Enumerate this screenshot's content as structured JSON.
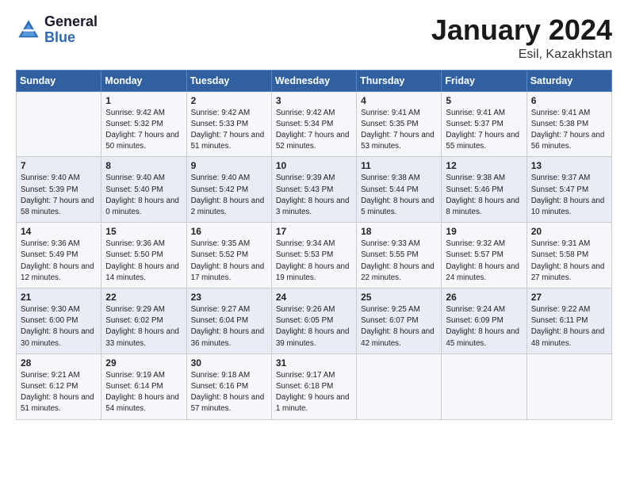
{
  "header": {
    "logo_general": "General",
    "logo_blue": "Blue",
    "title": "January 2024",
    "location": "Esil, Kazakhstan"
  },
  "weekdays": [
    "Sunday",
    "Monday",
    "Tuesday",
    "Wednesday",
    "Thursday",
    "Friday",
    "Saturday"
  ],
  "weeks": [
    [
      {
        "day": "",
        "sunrise": "",
        "sunset": "",
        "daylight": ""
      },
      {
        "day": "1",
        "sunrise": "Sunrise: 9:42 AM",
        "sunset": "Sunset: 5:32 PM",
        "daylight": "Daylight: 7 hours and 50 minutes."
      },
      {
        "day": "2",
        "sunrise": "Sunrise: 9:42 AM",
        "sunset": "Sunset: 5:33 PM",
        "daylight": "Daylight: 7 hours and 51 minutes."
      },
      {
        "day": "3",
        "sunrise": "Sunrise: 9:42 AM",
        "sunset": "Sunset: 5:34 PM",
        "daylight": "Daylight: 7 hours and 52 minutes."
      },
      {
        "day": "4",
        "sunrise": "Sunrise: 9:41 AM",
        "sunset": "Sunset: 5:35 PM",
        "daylight": "Daylight: 7 hours and 53 minutes."
      },
      {
        "day": "5",
        "sunrise": "Sunrise: 9:41 AM",
        "sunset": "Sunset: 5:37 PM",
        "daylight": "Daylight: 7 hours and 55 minutes."
      },
      {
        "day": "6",
        "sunrise": "Sunrise: 9:41 AM",
        "sunset": "Sunset: 5:38 PM",
        "daylight": "Daylight: 7 hours and 56 minutes."
      }
    ],
    [
      {
        "day": "7",
        "sunrise": "Sunrise: 9:40 AM",
        "sunset": "Sunset: 5:39 PM",
        "daylight": "Daylight: 7 hours and 58 minutes."
      },
      {
        "day": "8",
        "sunrise": "Sunrise: 9:40 AM",
        "sunset": "Sunset: 5:40 PM",
        "daylight": "Daylight: 8 hours and 0 minutes."
      },
      {
        "day": "9",
        "sunrise": "Sunrise: 9:40 AM",
        "sunset": "Sunset: 5:42 PM",
        "daylight": "Daylight: 8 hours and 2 minutes."
      },
      {
        "day": "10",
        "sunrise": "Sunrise: 9:39 AM",
        "sunset": "Sunset: 5:43 PM",
        "daylight": "Daylight: 8 hours and 3 minutes."
      },
      {
        "day": "11",
        "sunrise": "Sunrise: 9:38 AM",
        "sunset": "Sunset: 5:44 PM",
        "daylight": "Daylight: 8 hours and 5 minutes."
      },
      {
        "day": "12",
        "sunrise": "Sunrise: 9:38 AM",
        "sunset": "Sunset: 5:46 PM",
        "daylight": "Daylight: 8 hours and 8 minutes."
      },
      {
        "day": "13",
        "sunrise": "Sunrise: 9:37 AM",
        "sunset": "Sunset: 5:47 PM",
        "daylight": "Daylight: 8 hours and 10 minutes."
      }
    ],
    [
      {
        "day": "14",
        "sunrise": "Sunrise: 9:36 AM",
        "sunset": "Sunset: 5:49 PM",
        "daylight": "Daylight: 8 hours and 12 minutes."
      },
      {
        "day": "15",
        "sunrise": "Sunrise: 9:36 AM",
        "sunset": "Sunset: 5:50 PM",
        "daylight": "Daylight: 8 hours and 14 minutes."
      },
      {
        "day": "16",
        "sunrise": "Sunrise: 9:35 AM",
        "sunset": "Sunset: 5:52 PM",
        "daylight": "Daylight: 8 hours and 17 minutes."
      },
      {
        "day": "17",
        "sunrise": "Sunrise: 9:34 AM",
        "sunset": "Sunset: 5:53 PM",
        "daylight": "Daylight: 8 hours and 19 minutes."
      },
      {
        "day": "18",
        "sunrise": "Sunrise: 9:33 AM",
        "sunset": "Sunset: 5:55 PM",
        "daylight": "Daylight: 8 hours and 22 minutes."
      },
      {
        "day": "19",
        "sunrise": "Sunrise: 9:32 AM",
        "sunset": "Sunset: 5:57 PM",
        "daylight": "Daylight: 8 hours and 24 minutes."
      },
      {
        "day": "20",
        "sunrise": "Sunrise: 9:31 AM",
        "sunset": "Sunset: 5:58 PM",
        "daylight": "Daylight: 8 hours and 27 minutes."
      }
    ],
    [
      {
        "day": "21",
        "sunrise": "Sunrise: 9:30 AM",
        "sunset": "Sunset: 6:00 PM",
        "daylight": "Daylight: 8 hours and 30 minutes."
      },
      {
        "day": "22",
        "sunrise": "Sunrise: 9:29 AM",
        "sunset": "Sunset: 6:02 PM",
        "daylight": "Daylight: 8 hours and 33 minutes."
      },
      {
        "day": "23",
        "sunrise": "Sunrise: 9:27 AM",
        "sunset": "Sunset: 6:04 PM",
        "daylight": "Daylight: 8 hours and 36 minutes."
      },
      {
        "day": "24",
        "sunrise": "Sunrise: 9:26 AM",
        "sunset": "Sunset: 6:05 PM",
        "daylight": "Daylight: 8 hours and 39 minutes."
      },
      {
        "day": "25",
        "sunrise": "Sunrise: 9:25 AM",
        "sunset": "Sunset: 6:07 PM",
        "daylight": "Daylight: 8 hours and 42 minutes."
      },
      {
        "day": "26",
        "sunrise": "Sunrise: 9:24 AM",
        "sunset": "Sunset: 6:09 PM",
        "daylight": "Daylight: 8 hours and 45 minutes."
      },
      {
        "day": "27",
        "sunrise": "Sunrise: 9:22 AM",
        "sunset": "Sunset: 6:11 PM",
        "daylight": "Daylight: 8 hours and 48 minutes."
      }
    ],
    [
      {
        "day": "28",
        "sunrise": "Sunrise: 9:21 AM",
        "sunset": "Sunset: 6:12 PM",
        "daylight": "Daylight: 8 hours and 51 minutes."
      },
      {
        "day": "29",
        "sunrise": "Sunrise: 9:19 AM",
        "sunset": "Sunset: 6:14 PM",
        "daylight": "Daylight: 8 hours and 54 minutes."
      },
      {
        "day": "30",
        "sunrise": "Sunrise: 9:18 AM",
        "sunset": "Sunset: 6:16 PM",
        "daylight": "Daylight: 8 hours and 57 minutes."
      },
      {
        "day": "31",
        "sunrise": "Sunrise: 9:17 AM",
        "sunset": "Sunset: 6:18 PM",
        "daylight": "Daylight: 9 hours and 1 minute."
      },
      {
        "day": "",
        "sunrise": "",
        "sunset": "",
        "daylight": ""
      },
      {
        "day": "",
        "sunrise": "",
        "sunset": "",
        "daylight": ""
      },
      {
        "day": "",
        "sunrise": "",
        "sunset": "",
        "daylight": ""
      }
    ]
  ]
}
